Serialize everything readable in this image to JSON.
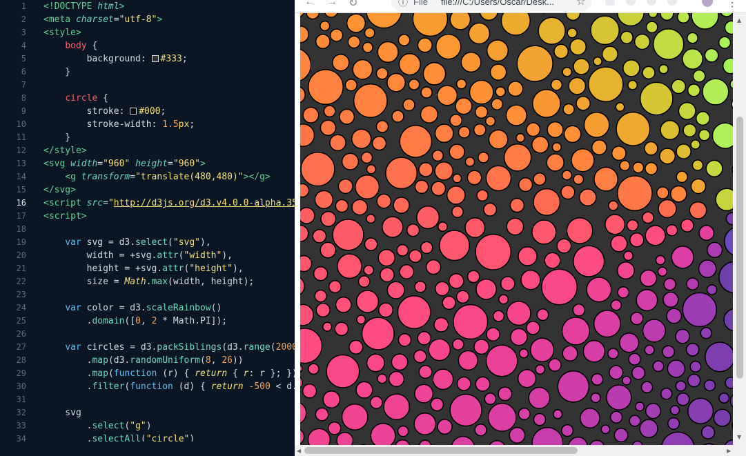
{
  "editor": {
    "line_numbers": [
      "1",
      "2",
      "3",
      "4",
      "5",
      "6",
      "7",
      "8",
      "9",
      "10",
      "11",
      "12",
      "13",
      "14",
      "15",
      "16",
      "17",
      "18",
      "19",
      "20",
      "21",
      "22",
      "23",
      "24",
      "25",
      "26",
      "27",
      "28",
      "29",
      "30",
      "31",
      "32",
      "33",
      "34"
    ],
    "active_line": "16",
    "lines": [
      [
        [
          "tg",
          "<!DOCTYPE "
        ],
        [
          "at",
          "html"
        ],
        [
          "tg",
          ">"
        ]
      ],
      [
        [
          "tg",
          "<meta "
        ],
        [
          "at",
          "charset"
        ],
        [
          "pn",
          "="
        ],
        [
          "st",
          "\"utf-8\""
        ],
        [
          "tg",
          ">"
        ]
      ],
      [
        [
          "tg",
          "<style>"
        ]
      ],
      [
        [
          "pn",
          "    "
        ],
        [
          "sel",
          "body"
        ],
        [
          "pn",
          " {"
        ]
      ],
      [
        [
          "pn",
          "        background: "
        ],
        [
          "sw",
          "#333333"
        ],
        [
          "st",
          "#333"
        ],
        [
          "pn",
          ";"
        ]
      ],
      [
        [
          "pn",
          "    }"
        ]
      ],
      [
        [
          "pn",
          ""
        ]
      ],
      [
        [
          "pn",
          "    "
        ],
        [
          "sel",
          "circle"
        ],
        [
          "pn",
          " {"
        ]
      ],
      [
        [
          "pn",
          "        stroke: "
        ],
        [
          "sw",
          "#000000"
        ],
        [
          "st",
          "#000"
        ],
        [
          "pn",
          ";"
        ]
      ],
      [
        [
          "pn",
          "        stroke-width: "
        ],
        [
          "nm",
          "1.5"
        ],
        [
          "st",
          "px"
        ],
        [
          "pn",
          ";"
        ]
      ],
      [
        [
          "pn",
          "    }"
        ]
      ],
      [
        [
          "tg",
          "</style>"
        ]
      ],
      [
        [
          "tg",
          "<svg "
        ],
        [
          "at",
          "width"
        ],
        [
          "pn",
          "="
        ],
        [
          "st",
          "\"960\""
        ],
        [
          "pn",
          " "
        ],
        [
          "at",
          "height"
        ],
        [
          "pn",
          "="
        ],
        [
          "st",
          "\"960\""
        ],
        [
          "tg",
          ">"
        ]
      ],
      [
        [
          "pn",
          "    "
        ],
        [
          "tg",
          "<g "
        ],
        [
          "at",
          "transform"
        ],
        [
          "pn",
          "="
        ],
        [
          "st",
          "\"translate(480,480)\""
        ],
        [
          "tg",
          "></g>"
        ]
      ],
      [
        [
          "tg",
          "</svg>"
        ]
      ],
      [
        [
          "tg",
          "<script "
        ],
        [
          "at",
          "src"
        ],
        [
          "pn",
          "="
        ],
        [
          "st",
          "\""
        ],
        [
          "ul",
          "http://d3js.org/d3.v4.0.0-alpha.35"
        ]
      ],
      [
        [
          "tg",
          "<script>"
        ]
      ],
      [
        [
          "pn",
          ""
        ]
      ],
      [
        [
          "pn",
          "    "
        ],
        [
          "kw",
          "var"
        ],
        [
          "pn",
          " svg = d3."
        ],
        [
          "fn",
          "select"
        ],
        [
          "pn",
          "("
        ],
        [
          "st",
          "\"svg\""
        ],
        [
          "pn",
          "),"
        ]
      ],
      [
        [
          "pn",
          "        width = +svg."
        ],
        [
          "fn",
          "attr"
        ],
        [
          "pn",
          "("
        ],
        [
          "st",
          "\"width\""
        ],
        [
          "pn",
          "),"
        ]
      ],
      [
        [
          "pn",
          "        height = +svg."
        ],
        [
          "fn",
          "attr"
        ],
        [
          "pn",
          "("
        ],
        [
          "st",
          "\"height\""
        ],
        [
          "pn",
          "),"
        ]
      ],
      [
        [
          "pn",
          "        size = "
        ],
        [
          "it",
          "Math"
        ],
        [
          "pn",
          "."
        ],
        [
          "fn",
          "max"
        ],
        [
          "pn",
          "(width, height);"
        ]
      ],
      [
        [
          "pn",
          ""
        ]
      ],
      [
        [
          "pn",
          "    "
        ],
        [
          "kw",
          "var"
        ],
        [
          "pn",
          " color = d3."
        ],
        [
          "fn",
          "scaleRainbow"
        ],
        [
          "pn",
          "()"
        ]
      ],
      [
        [
          "pn",
          "        ."
        ],
        [
          "fn",
          "domain"
        ],
        [
          "pn",
          "(["
        ],
        [
          "nm",
          "0"
        ],
        [
          "pn",
          ", "
        ],
        [
          "nm",
          "2"
        ],
        [
          "pn",
          " * Math.PI]);"
        ]
      ],
      [
        [
          "pn",
          ""
        ]
      ],
      [
        [
          "pn",
          "    "
        ],
        [
          "kw",
          "var"
        ],
        [
          "pn",
          " circles = d3."
        ],
        [
          "fn",
          "packSiblings"
        ],
        [
          "pn",
          "(d3."
        ],
        [
          "fn",
          "range"
        ],
        [
          "pn",
          "("
        ],
        [
          "nm",
          "2000"
        ]
      ],
      [
        [
          "pn",
          "        ."
        ],
        [
          "fn",
          "map"
        ],
        [
          "pn",
          "(d3."
        ],
        [
          "fn",
          "randomUniform"
        ],
        [
          "pn",
          "("
        ],
        [
          "nm",
          "8"
        ],
        [
          "pn",
          ", "
        ],
        [
          "nm",
          "26"
        ],
        [
          "pn",
          "))"
        ]
      ],
      [
        [
          "pn",
          "        ."
        ],
        [
          "fn",
          "map"
        ],
        [
          "pn",
          "("
        ],
        [
          "kw",
          "function"
        ],
        [
          "pn",
          " (r) { "
        ],
        [
          "it",
          "return"
        ],
        [
          "pn",
          " { "
        ],
        [
          "it",
          "r"
        ],
        [
          "pn",
          ": r }; })"
        ]
      ],
      [
        [
          "pn",
          "        ."
        ],
        [
          "fn",
          "filter"
        ],
        [
          "pn",
          "("
        ],
        [
          "kw",
          "function"
        ],
        [
          "pn",
          " (d) { "
        ],
        [
          "it",
          "return"
        ],
        [
          "pn",
          " "
        ],
        [
          "nm",
          "-500"
        ],
        [
          "pn",
          " < d.x"
        ]
      ],
      [
        [
          "pn",
          ""
        ]
      ],
      [
        [
          "pn",
          "    svg"
        ]
      ],
      [
        [
          "pn",
          "        ."
        ],
        [
          "fn",
          "select"
        ],
        [
          "pn",
          "("
        ],
        [
          "st",
          "\"g\""
        ],
        [
          "pn",
          ")"
        ]
      ],
      [
        [
          "pn",
          "        ."
        ],
        [
          "fn",
          "selectAll"
        ],
        [
          "pn",
          "("
        ],
        [
          "st",
          "\"circle\""
        ],
        [
          "pn",
          ")"
        ]
      ]
    ]
  },
  "browser": {
    "omnibox_label": "File",
    "url": "file:///C:/Users/Oscar/Desk...",
    "back_icon": "back-arrow-icon",
    "forward_icon": "forward-arrow-icon",
    "reload_icon": "reload-icon",
    "info_icon": "info-icon",
    "star_icon": "star-icon",
    "menu_icon": "kebab-menu-icon",
    "avatar_icon": "profile-avatar-icon"
  },
  "visualization": {
    "background": "#333333",
    "stroke": "#000000",
    "stroke_width_label": "1.5px",
    "color_scale": "rainbow"
  }
}
